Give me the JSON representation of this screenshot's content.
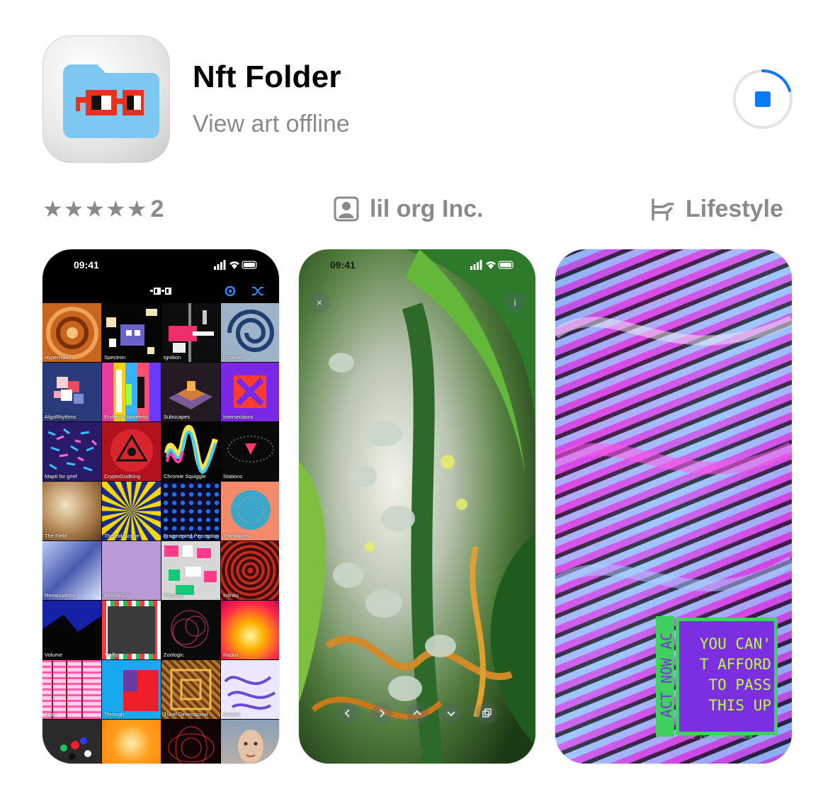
{
  "app": {
    "name": "Nft Folder",
    "subtitle": "View art offline",
    "icon": "folder-with-pixel-glasses-icon",
    "download_state": "downloading"
  },
  "info": {
    "stars": "★★★★★",
    "rating_count": "2",
    "developer": "lil org Inc.",
    "developer_icon": "person-square-icon",
    "category": "Lifestyle",
    "category_icon": "lounge-chair-icon"
  },
  "colors": {
    "accent": "#0a7aff",
    "secondary_text": "#8a8a8e",
    "folder_blue": "#7cc8f2",
    "glasses_red": "#e8321e"
  },
  "screenshots": {
    "s1": {
      "time": "09:41",
      "tiles": [
        "HyperHash",
        "Spectron",
        "Ignition",
        "Inspirals",
        "AlgoRhythms",
        "Endless Nameless",
        "Subscapes",
        "Intersections",
        "Mapti for grief",
        "CryptoGodKing",
        "Chromie Squiggle",
        "Stations",
        "The Field",
        "Thereidoscope",
        "Fragmented Perception",
        "Transitions",
        "Renaissance",
        "KERNELS",
        "Passing",
        "Infinito",
        "Volume",
        "Traffic",
        "Zoologic",
        "Radial",
        "Fiber",
        "Through",
        "Túnel Dimensional",
        "Extasis",
        "",
        "",
        "",
        ""
      ]
    },
    "s2": {
      "time": "09:41",
      "close_glyph": "×",
      "info_glyph": "i"
    },
    "s3": {
      "poster_text": "YOU CAN'\nT AFFORD\nTO PASS\nTHIS UP",
      "side_text": "ACT NOW AC",
      "caption": "TIME IS RUN  ACT NOW"
    }
  }
}
